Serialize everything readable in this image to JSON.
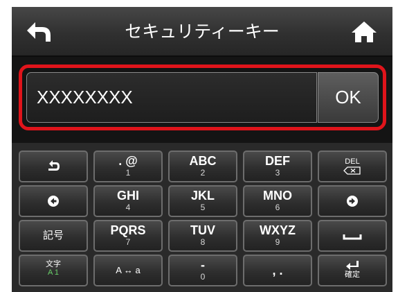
{
  "header": {
    "title": "セキュリティーキー",
    "back_icon": "back-arrow-icon",
    "home_icon": "home-icon"
  },
  "input": {
    "value": "XXXXXXXX",
    "ok_label": "OK",
    "highlight_color": "#e0141b"
  },
  "keyboard": {
    "keys": {
      "undo": "undo-icon",
      "k1_main": ". @",
      "k1_sub": "1",
      "k2_main": "ABC",
      "k2_sub": "2",
      "k3_main": "DEF",
      "k3_sub": "3",
      "del_label": "DEL",
      "left": "arrow-left-icon",
      "k4_main": "GHI",
      "k4_sub": "4",
      "k5_main": "JKL",
      "k5_sub": "5",
      "k6_main": "MNO",
      "k6_sub": "6",
      "right": "arrow-right-icon",
      "symbol": "記号",
      "k7_main": "PQRS",
      "k7_sub": "7",
      "k8_main": "TUV",
      "k8_sub": "8",
      "k9_main": "WXYZ",
      "k9_sub": "9",
      "space": "space-icon",
      "mode_top": "文字",
      "mode_bottom": "A 1",
      "case": "A ↔ a",
      "k0_main": "-",
      "k0_sub": "0",
      "punct": ",  .",
      "enter_label": "確定"
    }
  }
}
